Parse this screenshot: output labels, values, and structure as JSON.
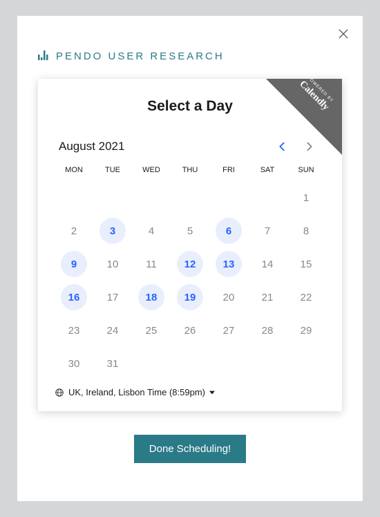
{
  "header": {
    "title": "PENDO USER RESEARCH"
  },
  "ribbon": {
    "powered_by": "POWERED BY",
    "brand": "Calendly"
  },
  "calendar": {
    "title": "Select a Day",
    "month_label": "August 2021",
    "weekdays": [
      "MON",
      "TUE",
      "WED",
      "THU",
      "FRI",
      "SAT",
      "SUN"
    ],
    "weeks": [
      [
        null,
        null,
        null,
        null,
        null,
        null,
        {
          "n": 1,
          "a": false
        }
      ],
      [
        {
          "n": 2,
          "a": false
        },
        {
          "n": 3,
          "a": true
        },
        {
          "n": 4,
          "a": false
        },
        {
          "n": 5,
          "a": false
        },
        {
          "n": 6,
          "a": true
        },
        {
          "n": 7,
          "a": false
        },
        {
          "n": 8,
          "a": false
        }
      ],
      [
        {
          "n": 9,
          "a": true
        },
        {
          "n": 10,
          "a": false
        },
        {
          "n": 11,
          "a": false
        },
        {
          "n": 12,
          "a": true
        },
        {
          "n": 13,
          "a": true
        },
        {
          "n": 14,
          "a": false
        },
        {
          "n": 15,
          "a": false
        }
      ],
      [
        {
          "n": 16,
          "a": true
        },
        {
          "n": 17,
          "a": false
        },
        {
          "n": 18,
          "a": true
        },
        {
          "n": 19,
          "a": true
        },
        {
          "n": 20,
          "a": false
        },
        {
          "n": 21,
          "a": false
        },
        {
          "n": 22,
          "a": false
        }
      ],
      [
        {
          "n": 23,
          "a": false
        },
        {
          "n": 24,
          "a": false
        },
        {
          "n": 25,
          "a": false
        },
        {
          "n": 26,
          "a": false
        },
        {
          "n": 27,
          "a": false
        },
        {
          "n": 28,
          "a": false
        },
        {
          "n": 29,
          "a": false
        }
      ],
      [
        {
          "n": 30,
          "a": false
        },
        {
          "n": 31,
          "a": false
        },
        null,
        null,
        null,
        null,
        null
      ]
    ],
    "timezone": "UK, Ireland, Lisbon Time (8:59pm)"
  },
  "footer": {
    "done_label": "Done Scheduling!"
  }
}
